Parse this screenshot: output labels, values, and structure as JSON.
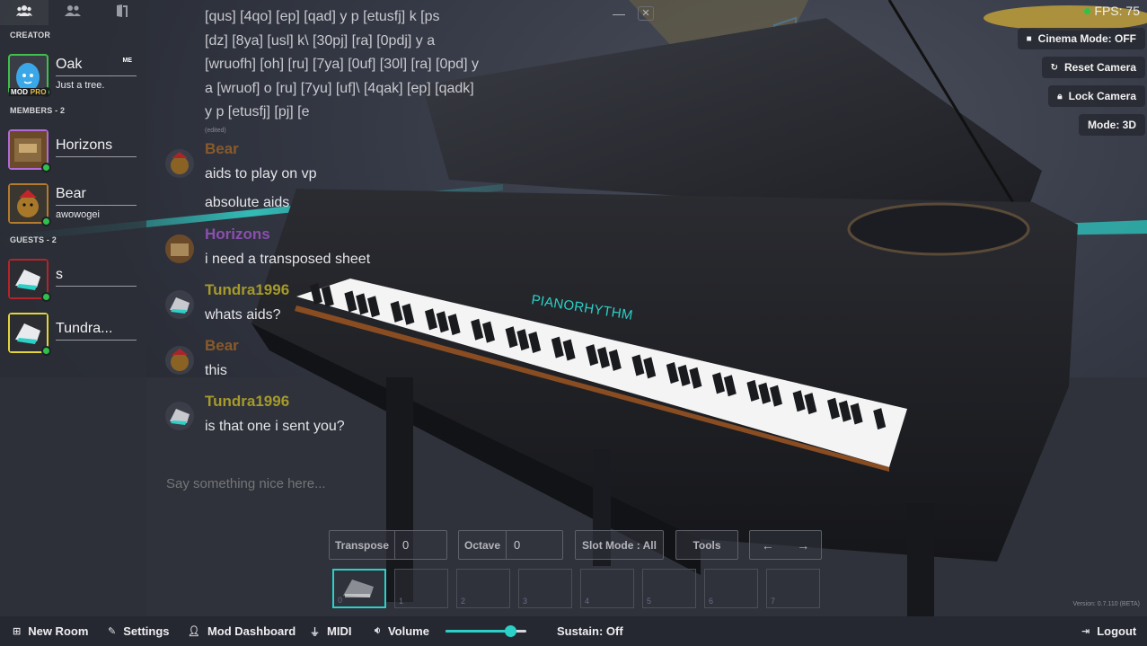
{
  "sidebar": {
    "tabs": [
      {
        "name": "users-tab",
        "icon": "users-icon",
        "active": true
      },
      {
        "name": "friends-tab",
        "icon": "friends-icon",
        "active": false
      },
      {
        "name": "rooms-tab",
        "icon": "door-icon",
        "active": false
      }
    ],
    "creator_header": "CREATOR",
    "creator": {
      "name": "Oak",
      "status": "Just a tree.",
      "me_badge": "ME",
      "mod_badge": "MOD",
      "pro_badge": "PRO",
      "border_color": "#3fbf4c"
    },
    "members_header": "MEMBERS - 2",
    "members": [
      {
        "name": "Horizons",
        "status": "",
        "border_color": "#b26ad6"
      },
      {
        "name": "Bear",
        "status": "awowogei",
        "border_color": "#b47a2e"
      }
    ],
    "guests_header": "GUESTS - 2",
    "guests": [
      {
        "name": "s",
        "status": "",
        "border_color": "#b5242a"
      },
      {
        "name": "Tundra...",
        "status": "",
        "border_color": "#e2d43a"
      }
    ]
  },
  "chat": {
    "history_lines": [
      "[qus] [4qo] [ep] [qad] y p [etusfj] k [ps",
      "[dz] [8ya] [usl] k\\ [30pj] [ra] [0pdj] y a",
      "[wruofh] [oh] [ru] [7ya] [0uf] [30l] [ra] [0pd] y",
      "a [wruof] o [ru] [7yu] [uf]\\ [4qak] [ep] [qadk]",
      "y p [etusfj] [pj] [e"
    ],
    "edited_label": "(edited)",
    "messages": [
      {
        "user": "Bear",
        "color": "#8a5a2a",
        "lines": [
          "aids to play on vp",
          "absolute aids"
        ]
      },
      {
        "user": "Horizons",
        "color": "#8a4fae",
        "lines": [
          "i need a transposed sheet"
        ]
      },
      {
        "user": "Tundra1996",
        "color": "#a59a2a",
        "lines": [
          "whats aids?"
        ]
      },
      {
        "user": "Bear",
        "color": "#8a5a2a",
        "lines": [
          "this"
        ]
      },
      {
        "user": "Tundra1996",
        "color": "#a59a2a",
        "lines": [
          "is that one i sent you?"
        ]
      }
    ],
    "input_placeholder": "Say something nice here...",
    "minimize_icon": "minimize-icon",
    "close_icon": "close-icon"
  },
  "hud": {
    "fps_label": "FPS: 75",
    "cinema_mode": "Cinema Mode: OFF",
    "reset_camera": "Reset Camera",
    "lock_camera": "Lock Camera",
    "mode": "Mode: 3D"
  },
  "piano": {
    "brand": "PIANORHYTHM",
    "transpose_label": "Transpose",
    "transpose_value": "0",
    "octave_label": "Octave",
    "octave_value": "0",
    "slot_mode": "Slot Mode : All",
    "tools": "Tools",
    "prev_icon": "arrow-left-icon",
    "next_icon": "arrow-right-icon",
    "slots": [
      "0",
      "1",
      "2",
      "3",
      "4",
      "5",
      "6",
      "7"
    ],
    "active_slot": 0
  },
  "bottom_bar": {
    "new_room": "New Room",
    "settings": "Settings",
    "mod_dashboard": "Mod Dashboard",
    "midi": "MIDI",
    "volume": "Volume",
    "volume_level": 0.8,
    "sustain": "Sustain: Off",
    "logout": "Logout"
  },
  "version": "Version: 0.7.110 (BETA)",
  "colors": {
    "accent": "#2bd0c7",
    "online": "#2fc24a"
  }
}
